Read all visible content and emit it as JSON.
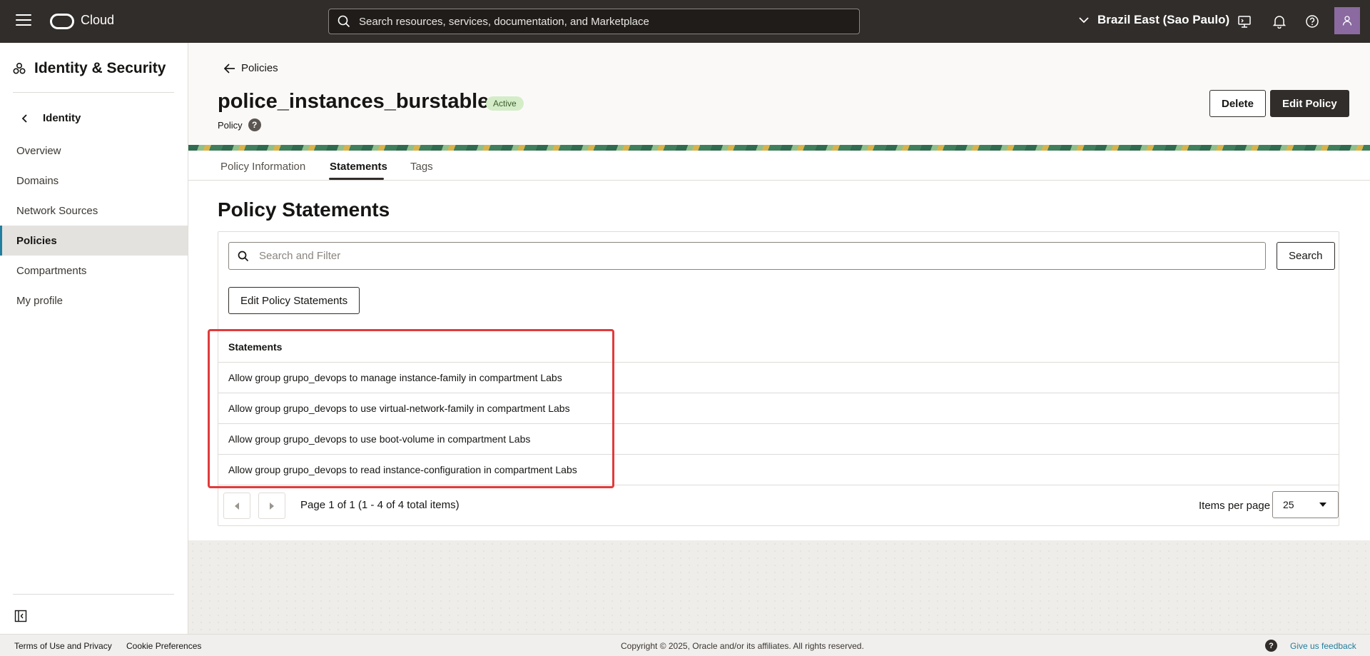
{
  "topbar": {
    "brand": "Cloud",
    "search_placeholder": "Search resources, services, documentation, and Marketplace",
    "region": "Brazil East (Sao Paulo)"
  },
  "sidebar": {
    "title": "Identity & Security",
    "back_label": "Identity",
    "items": [
      {
        "label": "Overview"
      },
      {
        "label": "Domains"
      },
      {
        "label": "Network Sources"
      },
      {
        "label": "Policies"
      },
      {
        "label": "Compartments"
      },
      {
        "label": "My profile"
      }
    ]
  },
  "header": {
    "back_label": "Policies",
    "title": "police_instances_burstable",
    "status": "Active",
    "subtitle": "Policy",
    "delete_label": "Delete",
    "edit_label": "Edit Policy"
  },
  "tabs": [
    {
      "label": "Policy Information"
    },
    {
      "label": "Statements"
    },
    {
      "label": "Tags"
    }
  ],
  "statements": {
    "title": "Policy Statements",
    "filter_placeholder": "Search and Filter",
    "search_label": "Search",
    "edit_label": "Edit Policy Statements",
    "column": "Statements",
    "rows": [
      "Allow group grupo_devops to manage instance-family in compartment Labs",
      "Allow group grupo_devops to use virtual-network-family in compartment Labs",
      "Allow group grupo_devops to use boot-volume in compartment Labs",
      "Allow group grupo_devops to read instance-configuration in compartment Labs"
    ],
    "pagination": "Page 1 of 1 (1 - 4 of 4 total items)",
    "items_per_page_label": "Items per page",
    "items_per_page": "25"
  },
  "footer": {
    "terms": "Terms of Use and Privacy",
    "cookies": "Cookie Preferences",
    "copyright": "Copyright © 2025, Oracle and/or its affiliates. All rights reserved.",
    "feedback": "Give us feedback"
  }
}
